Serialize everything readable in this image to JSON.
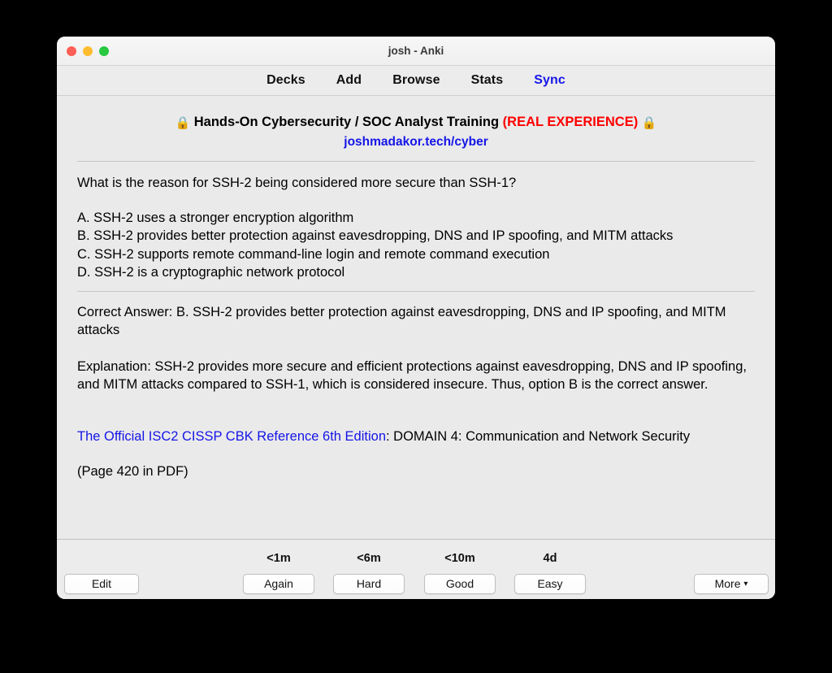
{
  "window": {
    "title": "josh - Anki",
    "traffic_lights": [
      {
        "name": "close",
        "color": "#ff5f57"
      },
      {
        "name": "minimize",
        "color": "#febc2e"
      },
      {
        "name": "zoom",
        "color": "#28c840"
      }
    ]
  },
  "nav": {
    "items": [
      {
        "label": "Decks",
        "active": false
      },
      {
        "label": "Add",
        "active": false
      },
      {
        "label": "Browse",
        "active": false
      },
      {
        "label": "Stats",
        "active": false
      },
      {
        "label": "Sync",
        "active": true
      }
    ],
    "sync_color": "#1515e8"
  },
  "card": {
    "banner": {
      "lock_left": "🔒",
      "lock_right": "🔒",
      "title": "Hands-On Cybersecurity / SOC Analyst Training",
      "tag": "(REAL EXPERIENCE)",
      "tag_color": "#ff0000",
      "url": "joshmadakor.tech/cyber",
      "url_color": "#1515e8"
    },
    "question": "What is the reason for SSH-2 being considered more secure than SSH-1?",
    "choices": [
      "A. SSH-2 uses a stronger encryption algorithm",
      "B. SSH-2 provides better protection against eavesdropping, DNS and IP spoofing, and MITM attacks",
      "C. SSH-2 supports remote command-line login and remote command execution",
      "D. SSH-2 is a cryptographic network protocol"
    ],
    "correct_answer": "Correct Answer: B. SSH-2 provides better protection against eavesdropping, DNS and IP spoofing, and MITM attacks",
    "explanation": "Explanation: SSH-2 provides more secure and efficient protections against eavesdropping, DNS and IP spoofing, and MITM attacks compared to SSH-1, which is considered insecure. Thus, option B is the correct answer.",
    "reference": {
      "link_text": "The Official ISC2 CISSP CBK Reference 6th Edition",
      "rest_text": ": DOMAIN 4: Communication and Network Security"
    },
    "page_note": "(Page 420 in PDF)"
  },
  "bottom_bar": {
    "edit_label": "Edit",
    "more_label": "More",
    "more_caret": "▾",
    "answer_buttons": [
      {
        "label": "Again",
        "interval": "<1m"
      },
      {
        "label": "Hard",
        "interval": "<6m"
      },
      {
        "label": "Good",
        "interval": "<10m"
      },
      {
        "label": "Easy",
        "interval": "4d"
      }
    ]
  }
}
